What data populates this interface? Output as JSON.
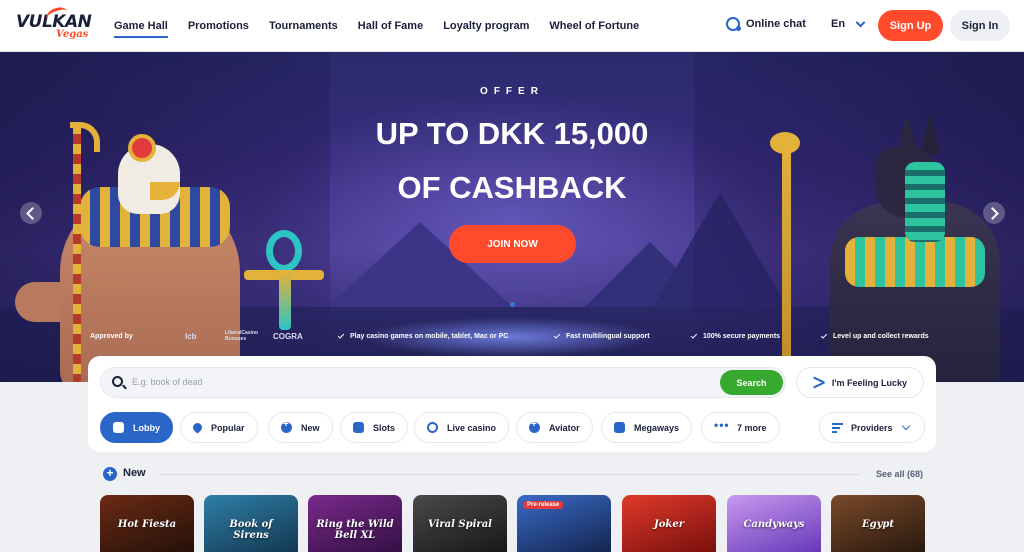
{
  "header": {
    "logo_text": "VULKAN",
    "logo_sub": "Vegas",
    "nav": [
      {
        "label": "Game Hall",
        "active": true
      },
      {
        "label": "Promotions",
        "active": false
      },
      {
        "label": "Tournaments",
        "active": false
      },
      {
        "label": "Hall of Fame",
        "active": false
      },
      {
        "label": "Loyalty program",
        "active": false
      },
      {
        "label": "Wheel of Fortune",
        "active": false
      }
    ],
    "online_chat": "Online chat",
    "language": "En",
    "sign_up": "Sign Up",
    "sign_in": "Sign In",
    "accent_color": "#ff4b2b",
    "primary_color": "#2a66c8"
  },
  "hero": {
    "offer_label": "OFFER",
    "headline_line1": "UP TO DKK 15,000",
    "headline_line2": "OF CASHBACK",
    "cta": "JOIN NOW",
    "trust": {
      "approved_by": "Approved by",
      "partners": [
        "lcb",
        "LiberalCasino Bonuses",
        "COGRA"
      ],
      "features": [
        "Play casino games on mobile, tablet, Mac or PC",
        "Fast multilingual support",
        "100% secure payments",
        "Level up and collect rewards"
      ]
    }
  },
  "search": {
    "placeholder": "E.g. book of dead",
    "button": "Search",
    "lucky": "I'm Feeling Lucky"
  },
  "categories": [
    {
      "label": "Lobby",
      "icon": "lobby-icon",
      "active": true
    },
    {
      "label": "Popular",
      "icon": "heart-icon",
      "active": false
    },
    {
      "label": "New",
      "icon": "plus-icon",
      "active": false
    },
    {
      "label": "Slots",
      "icon": "slots-icon",
      "active": false
    },
    {
      "label": "Live casino",
      "icon": "live-casino-icon",
      "active": false
    },
    {
      "label": "Aviator",
      "icon": "aviator-icon",
      "active": false
    },
    {
      "label": "Megaways",
      "icon": "megaways-icon",
      "active": false
    },
    {
      "label": "7 more",
      "icon": "more-dots-icon",
      "active": false
    }
  ],
  "providers": "Providers",
  "section": {
    "title": "New",
    "see_all": "See all (68)"
  },
  "games": [
    {
      "label": "Hot Fiesta",
      "color": "#3a1b12"
    },
    {
      "label": "Book of Sirens",
      "color": "#1e4d6e"
    },
    {
      "label": "Ring the Wild Bell XL",
      "color": "#4a1e5c"
    },
    {
      "label": "Viral Spiral",
      "color": "#2a2a2a"
    },
    {
      "label": "Pre-release",
      "color": "#1c3c7a",
      "badge": "Pre-release"
    },
    {
      "label": "Joker",
      "color": "#b22020"
    },
    {
      "label": "Candyways",
      "color": "#8a5ad8"
    },
    {
      "label": "Egypt",
      "color": "#3a2316"
    }
  ]
}
